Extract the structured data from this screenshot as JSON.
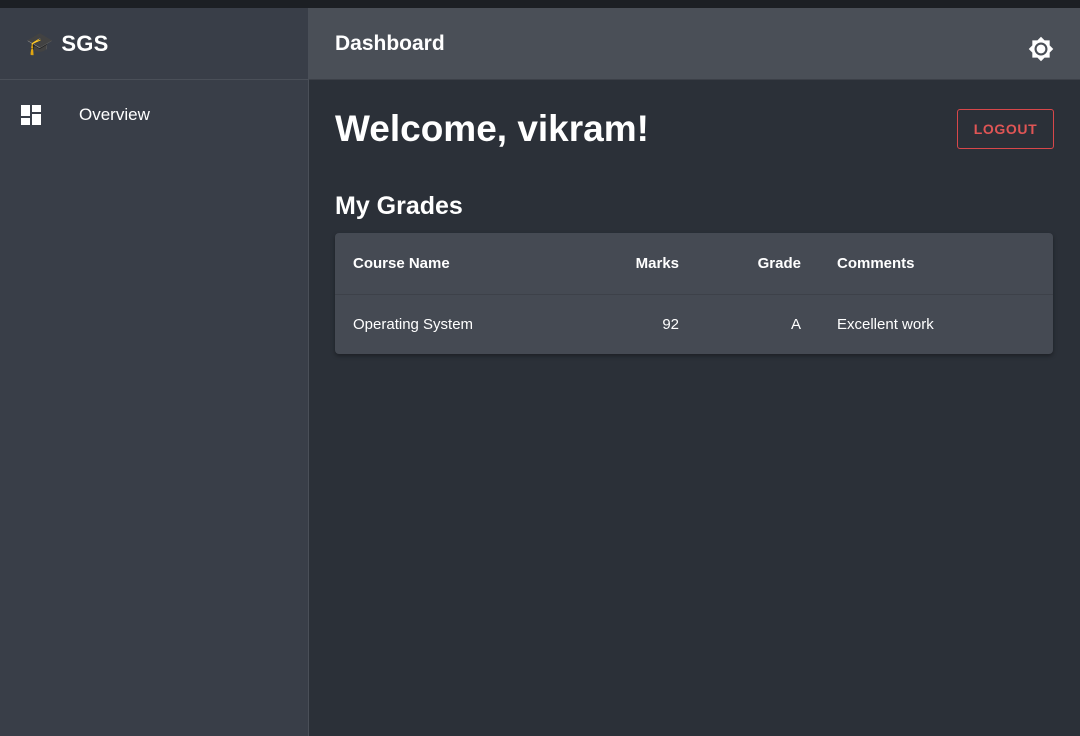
{
  "sidebar": {
    "brand_icon": "🎓",
    "brand_name": "SGS",
    "items": [
      {
        "label": "Overview",
        "icon": "dashboard-icon"
      }
    ]
  },
  "appbar": {
    "title": "Dashboard",
    "theme_icon": "brightness-icon"
  },
  "main": {
    "welcome": "Welcome, vikram!",
    "logout_label": "LOGOUT",
    "section_title": "My Grades",
    "table": {
      "headers": [
        "Course Name",
        "Marks",
        "Grade",
        "Comments"
      ],
      "rows": [
        [
          "Operating System",
          "92",
          "A",
          "Excellent work"
        ]
      ]
    }
  },
  "colors": {
    "sidebar_bg": "#393e48",
    "appbar_bg": "#4a4f57",
    "main_bg": "#2b3038",
    "card_bg": "#454a53",
    "logout_accent": "#e05555"
  }
}
